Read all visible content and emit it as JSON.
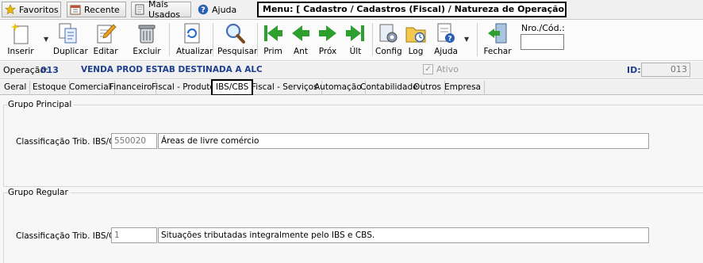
{
  "quickbar": {
    "favoritos": "Favoritos",
    "recente": "Recente",
    "mais_usados": "Mais Usados",
    "ajuda": "Ajuda",
    "menu_path": "Menu: [ Cadastro / Cadastros (Fiscal) / Natureza de Operação Próprio]"
  },
  "toolbar": {
    "inserir": "Inserir",
    "duplicar": "Duplicar",
    "editar": "Editar",
    "excluir": "Excluir",
    "atualizar": "Atualizar",
    "pesquisar": "Pesquisar",
    "prim": "Prim",
    "ant": "Ant",
    "prox": "Próx",
    "ult": "Últ",
    "config": "Config",
    "log": "Log",
    "ajuda": "Ajuda",
    "fechar": "Fechar",
    "nro_cod_label": "Nro./Cód.:",
    "nro_cod_value": ""
  },
  "operation": {
    "label": "Operação:",
    "number": "013",
    "description": "VENDA PROD ESTAB DESTINADA A ALC",
    "ativo_label": "Ativo",
    "ativo_checked": true,
    "id_label": "ID:",
    "id_value": "013"
  },
  "tabs": [
    {
      "label": "Geral"
    },
    {
      "label": "Estoque"
    },
    {
      "label": "Comercial"
    },
    {
      "label": "Financeiro"
    },
    {
      "label": "Fiscal - Produtos"
    },
    {
      "label": "IBS/CBS",
      "active": true
    },
    {
      "label": "Fiscal - Serviços"
    },
    {
      "label": "Automação"
    },
    {
      "label": "Contabilidade"
    },
    {
      "label": "Outros"
    },
    {
      "label": "Empresa"
    }
  ],
  "grupo_principal": {
    "title": "Grupo Principal",
    "field_label": "Classificação Trib. IBS/CBS:",
    "code": "550020",
    "description": "Áreas de livre comércio"
  },
  "grupo_regular": {
    "title": "Grupo Regular",
    "field_label": "Classificação Trib. IBS/CBS:",
    "code": "1",
    "description": "Situações tributadas integralmente pelo IBS e CBS."
  },
  "colors": {
    "accent_blue": "#1f3f8f",
    "arrow_green": "#2e9e2e"
  },
  "icons": {
    "favoritos": "star-icon",
    "recente": "calendar-icon",
    "mais_usados": "document-icon",
    "ajuda": "help-icon",
    "inserir": "new-sparkle-icon",
    "duplicar": "duplicate-icon",
    "editar": "edit-icon",
    "excluir": "trash-icon",
    "atualizar": "refresh-icon",
    "pesquisar": "magnifier-icon",
    "prim": "first-arrow-icon",
    "ant": "previous-arrow-icon",
    "prox": "next-arrow-icon",
    "ult": "last-arrow-icon",
    "config": "config-icon",
    "log": "log-folder-icon",
    "ajuda_tb": "help-doc-icon",
    "fechar": "exit-door-icon"
  }
}
